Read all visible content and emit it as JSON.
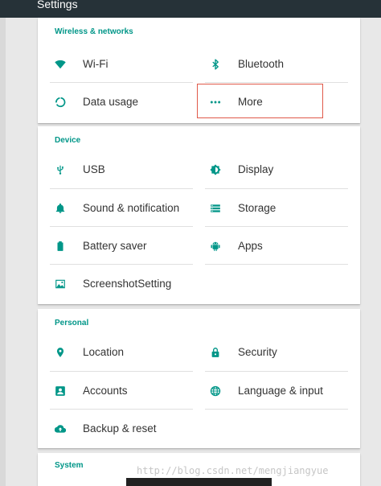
{
  "app": {
    "title": "Settings"
  },
  "colors": {
    "accent": "#009688",
    "topbar": "#263238",
    "highlight_box": "#e05a4a"
  },
  "sections": {
    "wireless": {
      "header": "Wireless & networks",
      "items": [
        {
          "label": "Wi-Fi",
          "icon": "wifi-icon"
        },
        {
          "label": "Bluetooth",
          "icon": "bluetooth-icon"
        },
        {
          "label": "Data usage",
          "icon": "data-usage-icon"
        },
        {
          "label": "More",
          "icon": "more-dots-icon"
        }
      ]
    },
    "device": {
      "header": "Device",
      "items": [
        {
          "label": "USB",
          "icon": "usb-icon"
        },
        {
          "label": "Display",
          "icon": "display-brightness-icon"
        },
        {
          "label": "Sound & notification",
          "icon": "bell-icon"
        },
        {
          "label": "Storage",
          "icon": "storage-icon"
        },
        {
          "label": "Battery saver",
          "icon": "battery-icon"
        },
        {
          "label": "Apps",
          "icon": "android-icon"
        },
        {
          "label": "ScreenshotSetting",
          "icon": "image-icon"
        }
      ]
    },
    "personal": {
      "header": "Personal",
      "items": [
        {
          "label": "Location",
          "icon": "location-pin-icon"
        },
        {
          "label": "Security",
          "icon": "lock-icon"
        },
        {
          "label": "Accounts",
          "icon": "account-box-icon"
        },
        {
          "label": "Language & input",
          "icon": "globe-icon"
        },
        {
          "label": "Backup & reset",
          "icon": "cloud-upload-icon"
        }
      ]
    },
    "system": {
      "header": "System"
    }
  },
  "watermark": "http://blog.csdn.net/mengjiangyue"
}
